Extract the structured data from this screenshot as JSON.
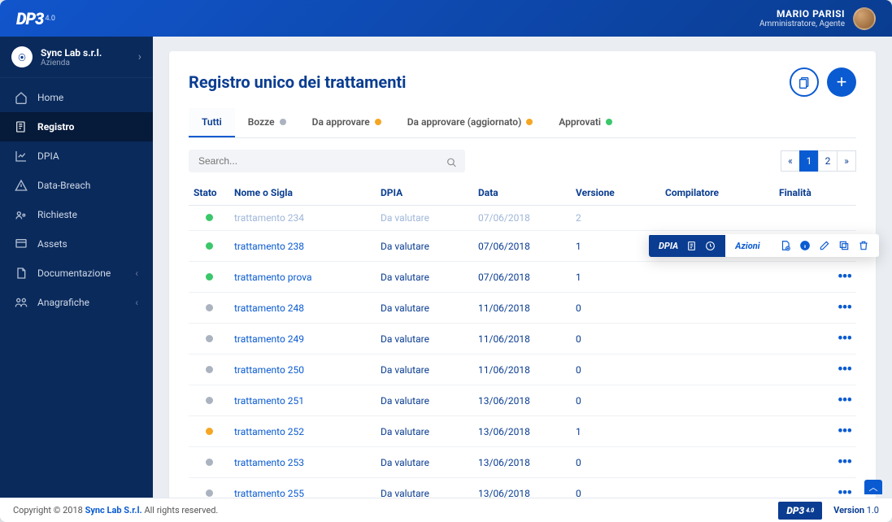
{
  "header": {
    "logo_text": "DP3",
    "logo_suffix": "4.0",
    "user_name": "MARIO PARISI",
    "user_role": "Amministratore, Agente"
  },
  "sidebar": {
    "company_name": "Sync Lab s.r.l.",
    "company_sub": "Azienda",
    "items": [
      {
        "label": "Home"
      },
      {
        "label": "Registro"
      },
      {
        "label": "DPIA"
      },
      {
        "label": "Data-Breach"
      },
      {
        "label": "Richieste"
      },
      {
        "label": "Assets"
      },
      {
        "label": "Documentazione"
      },
      {
        "label": "Anagrafiche"
      }
    ]
  },
  "page": {
    "title": "Registro unico dei trattamenti",
    "tabs": [
      {
        "label": "Tutti"
      },
      {
        "label": "Bozze"
      },
      {
        "label": "Da approvare"
      },
      {
        "label": "Da approvare (aggiornato)"
      },
      {
        "label": "Approvati"
      }
    ],
    "search_placeholder": "Search...",
    "pagination": {
      "prev": "«",
      "pages": [
        "1",
        "2"
      ],
      "next": "»",
      "active": "1"
    },
    "columns": {
      "stato": "Stato",
      "nome": "Nome o Sigla",
      "dpia": "DPIA",
      "data": "Data",
      "versione": "Versione",
      "compilatore": "Compilatore",
      "finalita": "Finalità"
    },
    "popover": {
      "dpia": "DPIA",
      "azioni": "Azioni"
    },
    "rows": [
      {
        "status": "green",
        "nome": "trattamento 234",
        "dpia": "Da valutare",
        "data": "07/06/2018",
        "versione": "2",
        "hover": true
      },
      {
        "status": "green",
        "nome": "trattamento 238",
        "dpia": "Da valutare",
        "data": "07/06/2018",
        "versione": "1"
      },
      {
        "status": "green",
        "nome": "trattamento prova",
        "dpia": "Da valutare",
        "data": "07/06/2018",
        "versione": "1"
      },
      {
        "status": "grey",
        "nome": "trattamento 248",
        "dpia": "Da valutare",
        "data": "11/06/2018",
        "versione": "0"
      },
      {
        "status": "grey",
        "nome": "trattamento 249",
        "dpia": "Da valutare",
        "data": "11/06/2018",
        "versione": "0"
      },
      {
        "status": "grey",
        "nome": "trattamento 250",
        "dpia": "Da valutare",
        "data": "11/06/2018",
        "versione": "0"
      },
      {
        "status": "grey",
        "nome": "trattamento 251",
        "dpia": "Da valutare",
        "data": "13/06/2018",
        "versione": "0"
      },
      {
        "status": "orange",
        "nome": "trattamento 252",
        "dpia": "Da valutare",
        "data": "13/06/2018",
        "versione": "1"
      },
      {
        "status": "grey",
        "nome": "trattamento 253",
        "dpia": "Da valutare",
        "data": "13/06/2018",
        "versione": "0"
      },
      {
        "status": "grey",
        "nome": "trattamento 255",
        "dpia": "Da valutare",
        "data": "13/06/2018",
        "versione": "0"
      }
    ]
  },
  "footer": {
    "copyright_pre": "Copyright © 2018 ",
    "copyright_company": "Sync Lab S.r.l.",
    "copyright_post": " All rights reserved.",
    "logo_text": "DP3",
    "logo_suffix": "4.0",
    "version_label": "Version",
    "version_value": " 1.0"
  }
}
